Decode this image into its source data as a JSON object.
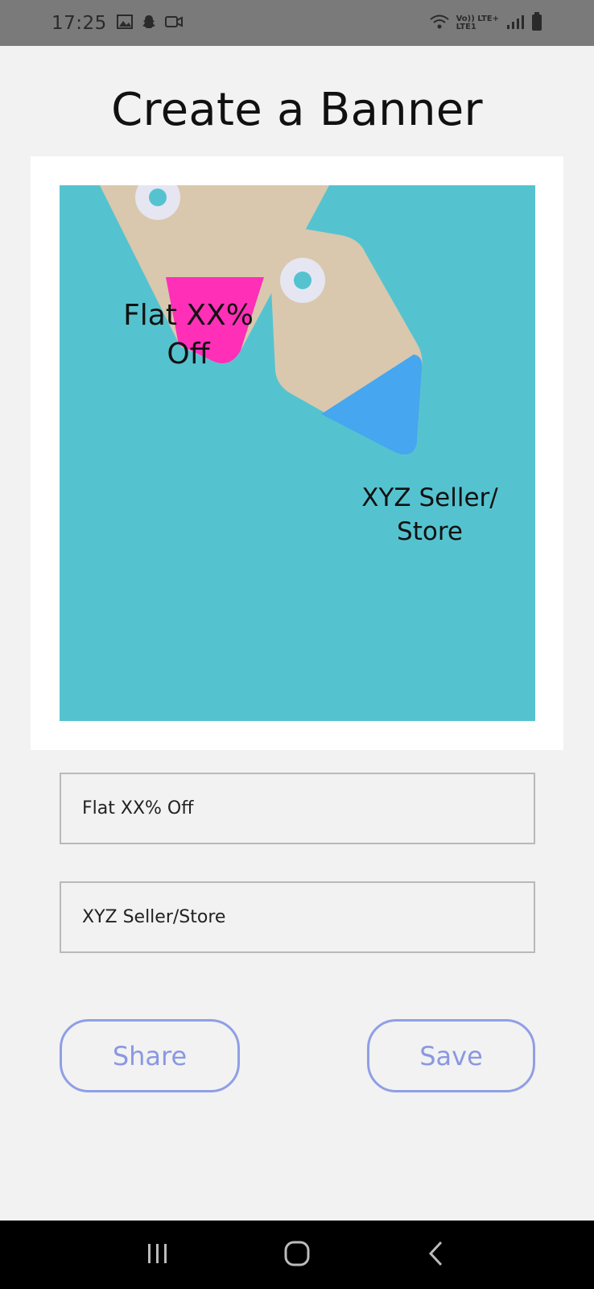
{
  "status_bar": {
    "time": "17:25",
    "network_top": "Vo)) LTE+",
    "network_bottom": "LTE1",
    "icons": [
      "gallery-icon",
      "snapchat-icon",
      "video-icon",
      "wifi-icon",
      "signal-icon",
      "battery-icon"
    ]
  },
  "page": {
    "title": "Create a Banner"
  },
  "banner": {
    "headline_line1": "Flat XX%",
    "headline_line2": "Off",
    "store_line1": "XYZ Seller/",
    "store_line2": "Store",
    "colors": {
      "background": "#55c3cf",
      "tag": "#d9c8ae",
      "tag_accent_pink": "#ff2fb8",
      "tag_accent_blue": "#46a6ef"
    }
  },
  "inputs": {
    "headline_value": "Flat XX% Off",
    "store_value": "XYZ Seller/Store"
  },
  "actions": {
    "share_label": "Share",
    "save_label": "Save",
    "accent": "#8f9fe6"
  },
  "nav_bar": {
    "icons": [
      "recents-icon",
      "home-icon",
      "back-icon"
    ]
  }
}
